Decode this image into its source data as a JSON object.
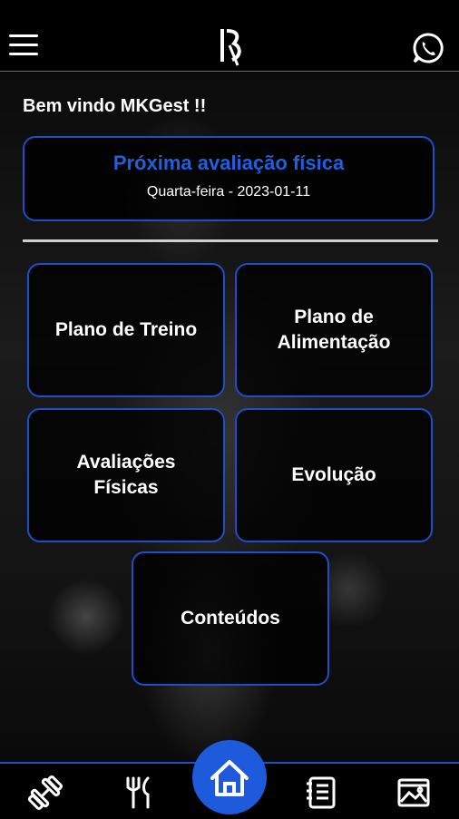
{
  "header": {
    "menu_icon": "hamburger-menu-icon",
    "logo_icon": "brand-logo",
    "whatsapp_icon": "whatsapp-icon"
  },
  "welcome_text": "Bem vindo MKGest !!",
  "next_assessment": {
    "title": "Próxima avaliação física",
    "date": "Quarta-feira - 2023-01-11"
  },
  "tiles": [
    {
      "label": "Plano de Treino"
    },
    {
      "label": "Plano de\nAlimentação"
    },
    {
      "label": "Avaliações\nFísicas"
    },
    {
      "label": "Evolução"
    },
    {
      "label": "Conteúdos"
    }
  ],
  "tabbar": {
    "items": [
      "dumbbell-icon",
      "fork-knife-icon",
      "home-icon",
      "notebook-icon",
      "gallery-icon"
    ]
  },
  "colors": {
    "accent": "#1e5bdc",
    "border": "#1d4fc9",
    "background": "#000000"
  }
}
